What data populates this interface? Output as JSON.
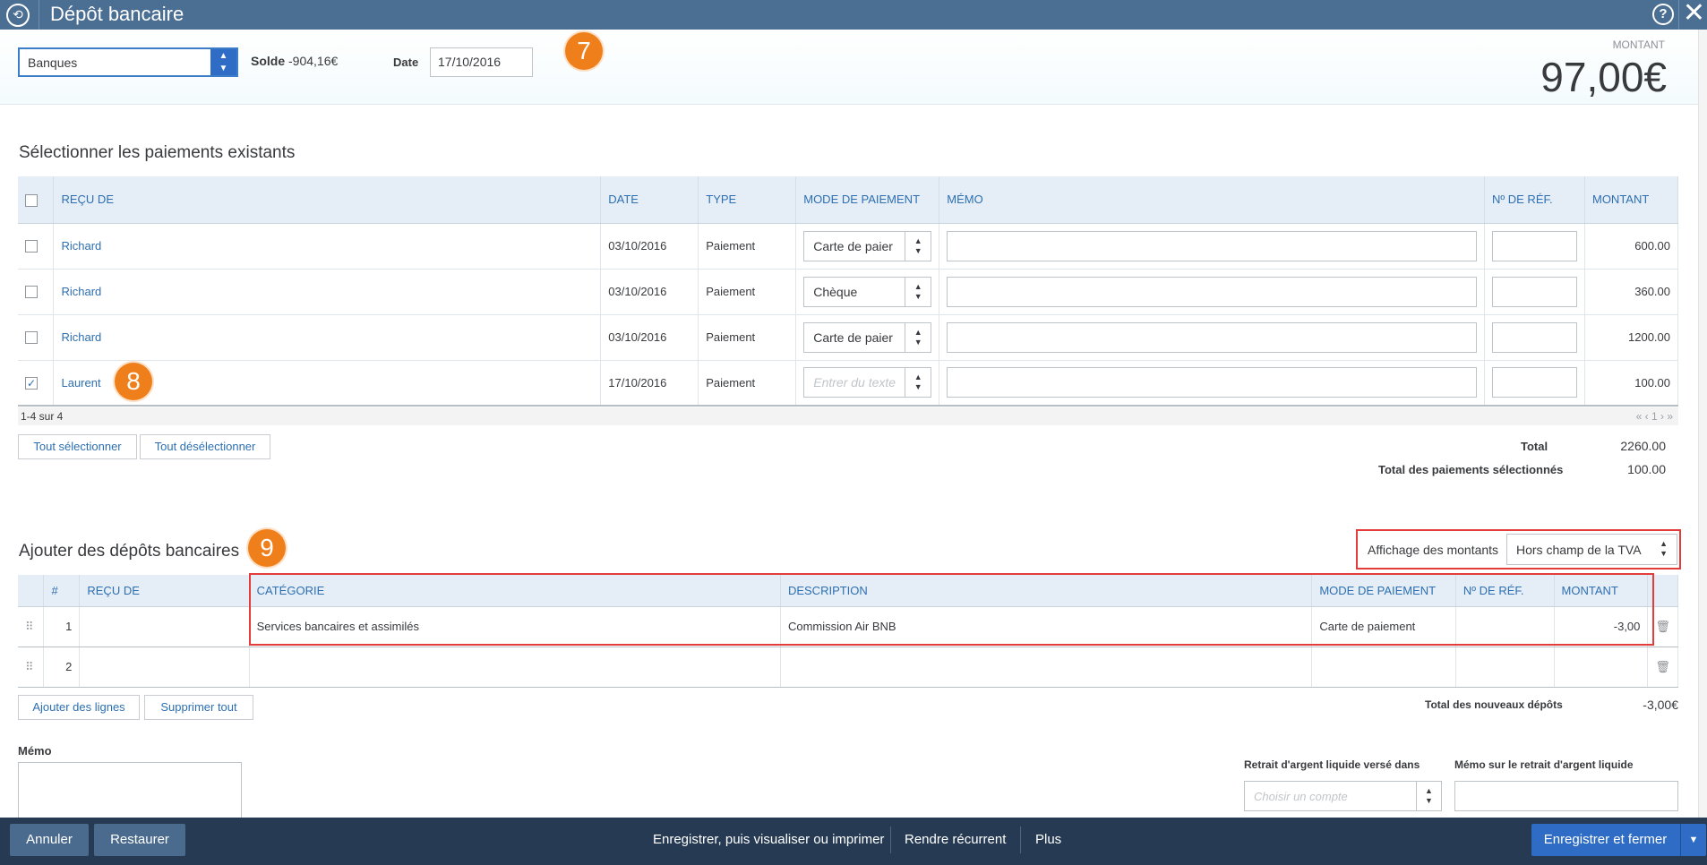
{
  "window": {
    "title": "Dépôt bancaire",
    "help_icon": "?",
    "close_icon": "✕",
    "history_icon": "⟲"
  },
  "header": {
    "account": "Banques",
    "solde_label": "Solde",
    "solde_value": "-904,16€",
    "date_label": "Date",
    "date_value": "17/10/2016",
    "amount_label": "MONTANT",
    "amount_value": "97,00€"
  },
  "badges": {
    "b7": "7",
    "b8": "8",
    "b9": "9"
  },
  "payments": {
    "title": "Sélectionner les paiements existants",
    "columns": [
      "REÇU DE",
      "DATE",
      "TYPE",
      "MODE DE PAIEMENT",
      "MÉMO",
      "Nº DE RÉF.",
      "MONTANT"
    ],
    "rows": [
      {
        "checked": false,
        "recu": "Richard",
        "date": "03/10/2016",
        "type": "Paiement",
        "mode": "Carte de paier",
        "montant": "600.00"
      },
      {
        "checked": false,
        "recu": "Richard",
        "date": "03/10/2016",
        "type": "Paiement",
        "mode": "Chèque",
        "montant": "360.00"
      },
      {
        "checked": false,
        "recu": "Richard",
        "date": "03/10/2016",
        "type": "Paiement",
        "mode": "Carte de paier",
        "montant": "1200.00"
      },
      {
        "checked": true,
        "recu": "Laurent",
        "date": "17/10/2016",
        "type": "Paiement",
        "mode_placeholder": "Entrer du texte",
        "montant": "100.00"
      }
    ],
    "pager_text": "1-4 sur 4",
    "pager_nav": "«  ‹  1  ›  »",
    "select_all": "Tout sélectionner",
    "deselect_all": "Tout désélectionner",
    "total_label": "Total",
    "total_value": "2260.00",
    "selected_label": "Total des paiements sélectionnés",
    "selected_value": "100.00"
  },
  "deposits": {
    "title": "Ajouter des dépôts bancaires",
    "display_label": "Affichage des montants",
    "display_value": "Hors champ de la TVA",
    "columns": [
      "#",
      "REÇU DE",
      "CATÉGORIE",
      "DESCRIPTION",
      "MODE DE PAIEMENT",
      "Nº DE RÉF.",
      "MONTANT"
    ],
    "rows": [
      {
        "n": "1",
        "recu": "",
        "categorie": "Services bancaires et assimilés",
        "description": "Commission Air BNB",
        "mode": "Carte de paiement",
        "ref": "",
        "montant": "-3,00"
      },
      {
        "n": "2",
        "recu": "",
        "categorie": "",
        "description": "",
        "mode": "",
        "ref": "",
        "montant": ""
      }
    ],
    "add_lines": "Ajouter des lignes",
    "delete_all": "Supprimer tout",
    "total_label": "Total des nouveaux dépôts",
    "total_value": "-3,00€"
  },
  "memo": {
    "label": "Mémo"
  },
  "cash": {
    "retrait_label": "Retrait d'argent liquide versé dans",
    "retrait_placeholder": "Choisir un compte",
    "memo_label": "Mémo sur le retrait d'argent liquide"
  },
  "footer": {
    "cancel": "Annuler",
    "restore": "Restaurer",
    "save_print": "Enregistrer, puis visualiser ou imprimer",
    "recurring": "Rendre récurrent",
    "more": "Plus",
    "save_close": "Enregistrer et fermer"
  },
  "colors": {
    "accent": "#2e6cc5",
    "titlebar": "#4b6e93",
    "footer": "#263b53",
    "badge": "#ef7f1a",
    "highlight": "#e23d3b"
  }
}
